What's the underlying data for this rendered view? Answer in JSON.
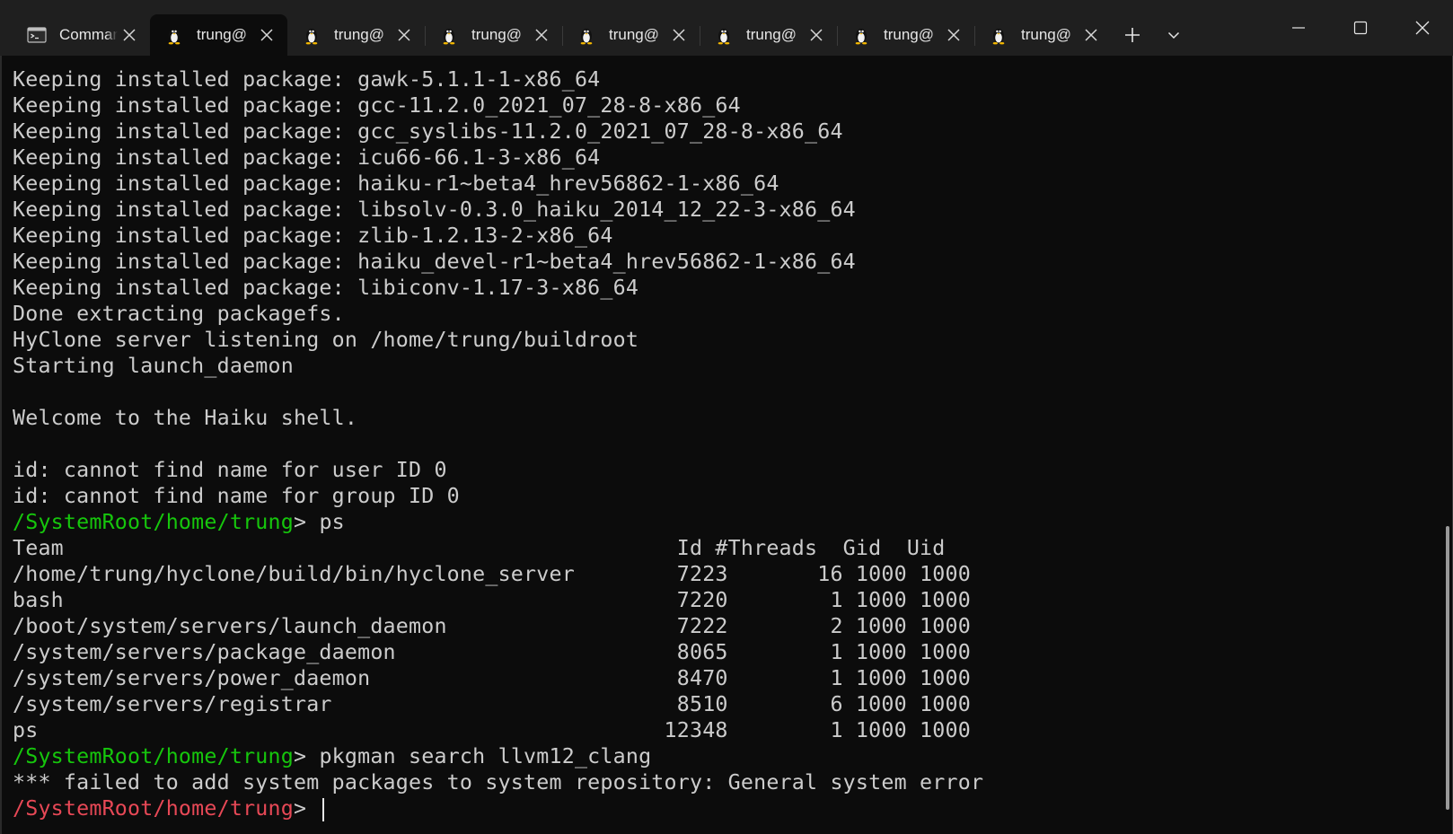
{
  "tabs": [
    {
      "title": "Command Prompt",
      "icon": "command-prompt-icon",
      "active": false
    },
    {
      "title": "trung@",
      "icon": "tux-penguin-icon",
      "active": true
    },
    {
      "title": "trung@",
      "icon": "tux-penguin-icon",
      "active": false
    },
    {
      "title": "trung@",
      "icon": "tux-penguin-icon",
      "active": false
    },
    {
      "title": "trung@",
      "icon": "tux-penguin-icon",
      "active": false
    },
    {
      "title": "trung@",
      "icon": "tux-penguin-icon",
      "active": false
    },
    {
      "title": "trung@",
      "icon": "tux-penguin-icon",
      "active": false
    },
    {
      "title": "trung@",
      "icon": "tux-penguin-icon",
      "active": false
    }
  ],
  "colors": {
    "background": "#0c0c0c",
    "tabbar": "#1f1f1f",
    "text": "#cccccc",
    "prompt_ok": "#16c60c",
    "prompt_error": "#e74856"
  },
  "terminal": {
    "lines": [
      "Keeping installed package: gawk-5.1.1-1-x86_64",
      "Keeping installed package: gcc-11.2.0_2021_07_28-8-x86_64",
      "Keeping installed package: gcc_syslibs-11.2.0_2021_07_28-8-x86_64",
      "Keeping installed package: icu66-66.1-3-x86_64",
      "Keeping installed package: haiku-r1~beta4_hrev56862-1-x86_64",
      "Keeping installed package: libsolv-0.3.0_haiku_2014_12_22-3-x86_64",
      "Keeping installed package: zlib-1.2.13-2-x86_64",
      "Keeping installed package: haiku_devel-r1~beta4_hrev56862-1-x86_64",
      "Keeping installed package: libiconv-1.17-3-x86_64",
      "Done extracting packagefs.",
      "HyClone server listening on /home/trung/buildroot",
      "Starting launch_daemon",
      "",
      "Welcome to the Haiku shell.",
      "",
      "id: cannot find name for user ID 0",
      "id: cannot find name for group ID 0"
    ],
    "prompt1": {
      "path": "/SystemRoot/home/trung",
      "symbol": "> ",
      "command": "ps"
    },
    "ps_header": "Team                                                Id #Threads  Gid  Uid",
    "ps_rows": [
      "/home/trung/hyclone/build/bin/hyclone_server        7223       16 1000 1000",
      "bash                                                7220        1 1000 1000",
      "/boot/system/servers/launch_daemon                  7222        2 1000 1000",
      "/system/servers/package_daemon                      8065        1 1000 1000",
      "/system/servers/power_daemon                        8470        1 1000 1000",
      "/system/servers/registrar                           8510        6 1000 1000",
      "ps                                                 12348        1 1000 1000"
    ],
    "prompt2": {
      "path": "/SystemRoot/home/trung",
      "symbol": "> ",
      "command": "pkgman search llvm12_clang"
    },
    "error_line": "*** failed to add system packages to system repository: General system error",
    "prompt3": {
      "path": "/SystemRoot/home/trung",
      "symbol": "> ",
      "command": ""
    }
  }
}
